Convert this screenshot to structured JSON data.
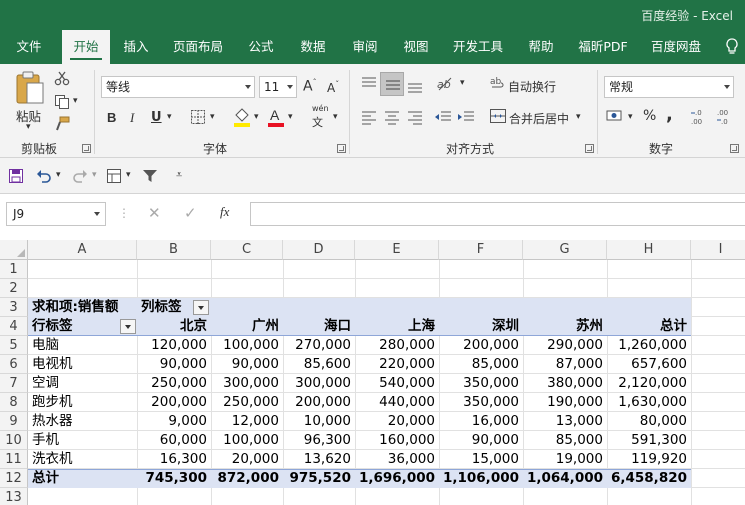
{
  "window": {
    "title": "百度经验 - Excel"
  },
  "ribbon_tabs": [
    "文件",
    "开始",
    "插入",
    "页面布局",
    "公式",
    "数据",
    "审阅",
    "视图",
    "开发工具",
    "帮助",
    "福昕PDF",
    "百度网盘"
  ],
  "active_tab": "开始",
  "clipboard": {
    "paste_label": "粘贴",
    "group_label": "剪贴板"
  },
  "font": {
    "name": "等线",
    "size": "11",
    "group_label": "字体",
    "bold": "B",
    "italic": "I",
    "underline": "U",
    "font_color": "#e81123",
    "fill_color": "#ffea00"
  },
  "alignment": {
    "wrap_label": "自动换行",
    "merge_label": "合并后居中",
    "group_label": "对齐方式"
  },
  "number": {
    "format": "常规",
    "percent": "%",
    "comma": ",",
    "group_label": "数字"
  },
  "formula_bar": {
    "name_box": "J9",
    "formula": ""
  },
  "columns": [
    "A",
    "B",
    "C",
    "D",
    "E",
    "F",
    "G",
    "H",
    "I"
  ],
  "rows": [
    "1",
    "2",
    "3",
    "4",
    "5",
    "6",
    "7",
    "8",
    "9",
    "10",
    "11",
    "12",
    "13"
  ],
  "pivot": {
    "value_label": "求和项:销售额",
    "col_label": "列标签",
    "row_label": "行标签",
    "headers": [
      "北京",
      "广州",
      "海口",
      "上海",
      "深圳",
      "苏州",
      "总计"
    ],
    "rows": [
      {
        "label": "电脑",
        "values": [
          "120,000",
          "100,000",
          "270,000",
          "280,000",
          "200,000",
          "290,000",
          "1,260,000"
        ]
      },
      {
        "label": "电视机",
        "values": [
          "90,000",
          "90,000",
          "85,600",
          "220,000",
          "85,000",
          "87,000",
          "657,600"
        ]
      },
      {
        "label": "空调",
        "values": [
          "250,000",
          "300,000",
          "300,000",
          "540,000",
          "350,000",
          "380,000",
          "2,120,000"
        ]
      },
      {
        "label": "跑步机",
        "values": [
          "200,000",
          "250,000",
          "200,000",
          "440,000",
          "350,000",
          "190,000",
          "1,630,000"
        ]
      },
      {
        "label": "热水器",
        "values": [
          "9,000",
          "12,000",
          "10,000",
          "20,000",
          "16,000",
          "13,000",
          "80,000"
        ]
      },
      {
        "label": "手机",
        "values": [
          "60,000",
          "100,000",
          "96,300",
          "160,000",
          "90,000",
          "85,000",
          "591,300"
        ]
      },
      {
        "label": "洗衣机",
        "values": [
          "16,300",
          "20,000",
          "13,620",
          "36,000",
          "15,000",
          "19,000",
          "119,920"
        ]
      }
    ],
    "total": {
      "label": "总计",
      "values": [
        "745,300",
        "872,000",
        "975,520",
        "1,696,000",
        "1,106,000",
        "1,064,000",
        "6,458,820"
      ]
    }
  },
  "colors": {
    "brand": "#217346",
    "pivot_band": "#dce3f3",
    "pivot_line": "#8ea6d8"
  }
}
